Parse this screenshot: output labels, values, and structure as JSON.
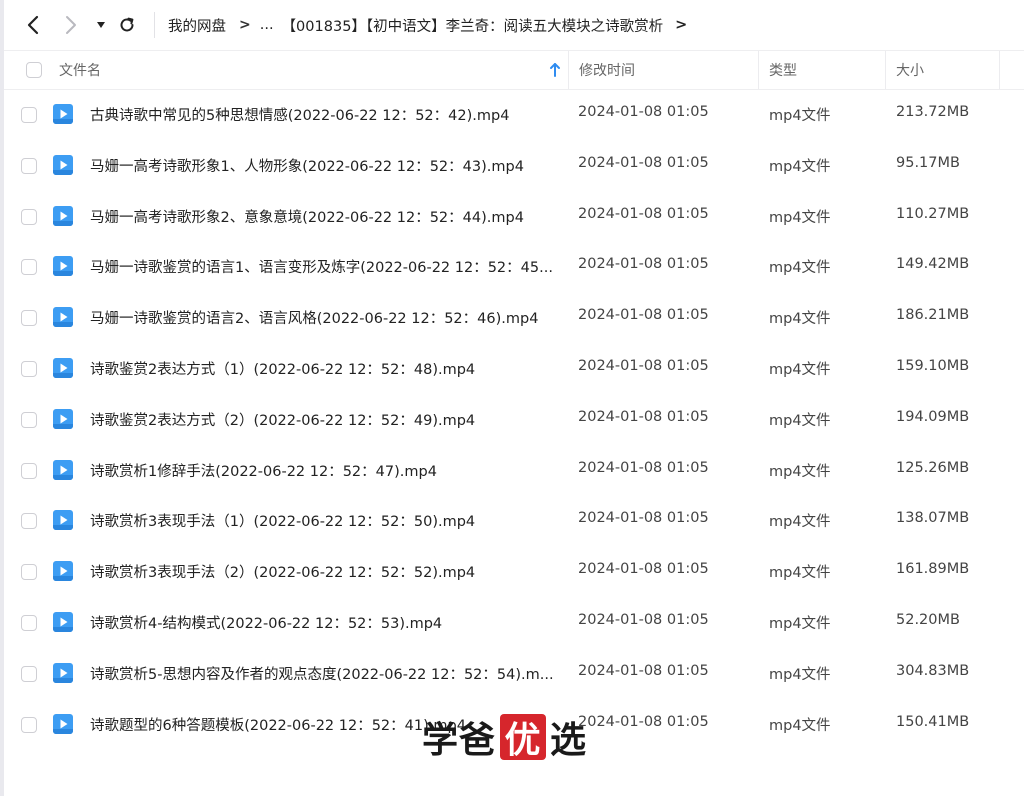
{
  "toolbar": {
    "back_icon": "chevron-left-icon",
    "forward_icon": "chevron-right-icon",
    "dropdown_icon": "caret-down-icon",
    "refresh_icon": "refresh-icon"
  },
  "breadcrumb": {
    "root": "我的网盘",
    "separator": ">",
    "ellipsis": "...",
    "current": "【001835】【初中语文】李兰奇：阅读五大模块之诗歌赏析",
    "trailing": ">"
  },
  "columns": {
    "name": "文件名",
    "modified": "修改时间",
    "type": "类型",
    "size": "大小"
  },
  "colors": {
    "accent": "#2f8cf0",
    "file_icon": "#3d9df3",
    "seal": "#d6262c"
  },
  "files": [
    {
      "name": "古典诗歌中常见的5种思想情感(2022-06-22 12：52：42).mp4",
      "modified": "2024-01-08 01:05",
      "type": "mp4文件",
      "size": "213.72MB"
    },
    {
      "name": "马姗一高考诗歌形象1、人物形象(2022-06-22 12：52：43).mp4",
      "modified": "2024-01-08 01:05",
      "type": "mp4文件",
      "size": "95.17MB"
    },
    {
      "name": "马姗一高考诗歌形象2、意象意境(2022-06-22 12：52：44).mp4",
      "modified": "2024-01-08 01:05",
      "type": "mp4文件",
      "size": "110.27MB"
    },
    {
      "name": "马姗一诗歌鉴赏的语言1、语言变形及炼字(2022-06-22 12：52：45...",
      "modified": "2024-01-08 01:05",
      "type": "mp4文件",
      "size": "149.42MB"
    },
    {
      "name": "马姗一诗歌鉴赏的语言2、语言风格(2022-06-22 12：52：46).mp4",
      "modified": "2024-01-08 01:05",
      "type": "mp4文件",
      "size": "186.21MB"
    },
    {
      "name": "诗歌鉴赏2表达方式（1）(2022-06-22 12：52：48).mp4",
      "modified": "2024-01-08 01:05",
      "type": "mp4文件",
      "size": "159.10MB"
    },
    {
      "name": "诗歌鉴赏2表达方式（2）(2022-06-22 12：52：49).mp4",
      "modified": "2024-01-08 01:05",
      "type": "mp4文件",
      "size": "194.09MB"
    },
    {
      "name": "诗歌赏析1修辞手法(2022-06-22 12：52：47).mp4",
      "modified": "2024-01-08 01:05",
      "type": "mp4文件",
      "size": "125.26MB"
    },
    {
      "name": "诗歌赏析3表现手法（1）(2022-06-22 12：52：50).mp4",
      "modified": "2024-01-08 01:05",
      "type": "mp4文件",
      "size": "138.07MB"
    },
    {
      "name": "诗歌赏析3表现手法（2）(2022-06-22 12：52：52).mp4",
      "modified": "2024-01-08 01:05",
      "type": "mp4文件",
      "size": "161.89MB"
    },
    {
      "name": "诗歌赏析4-结构模式(2022-06-22 12：52：53).mp4",
      "modified": "2024-01-08 01:05",
      "type": "mp4文件",
      "size": "52.20MB"
    },
    {
      "name": "诗歌赏析5-思想内容及作者的观点态度(2022-06-22 12：52：54).m...",
      "modified": "2024-01-08 01:05",
      "type": "mp4文件",
      "size": "304.83MB"
    },
    {
      "name": "诗歌题型的6种答题模板(2022-06-22 12：52：41).mp4",
      "modified": "2024-01-08 01:05",
      "type": "mp4文件",
      "size": "150.41MB"
    }
  ],
  "watermark": {
    "part1": "学爸",
    "seal": "优",
    "part2": "选"
  }
}
